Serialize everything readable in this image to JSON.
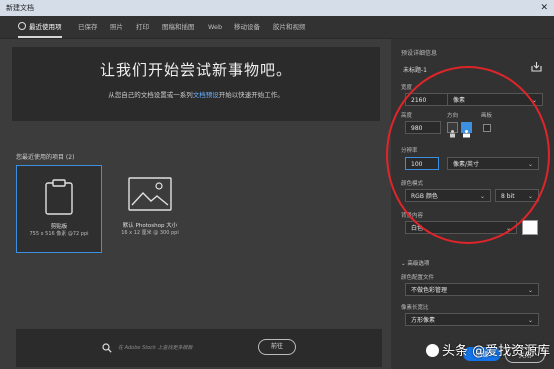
{
  "window": {
    "title": "新建文档",
    "close_glyph": "✕"
  },
  "tabs": [
    {
      "label": "最近使用项",
      "active": true
    },
    {
      "label": "已保存"
    },
    {
      "label": "照片"
    },
    {
      "label": "打印"
    },
    {
      "label": "图稿和插图"
    },
    {
      "label": "Web"
    },
    {
      "label": "移动设备"
    },
    {
      "label": "胶片和视频"
    }
  ],
  "hero": {
    "headline": "让我们开始尝试新事物吧。",
    "sub_before": "从您自己的文档设置或一系列",
    "sub_link": "文档预设",
    "sub_after": "开始以快速开始工作。"
  },
  "recent": {
    "label": "您最近使用的项目 (2)",
    "items": [
      {
        "name": "剪贴板",
        "dims": "755 x 516 像素 @72 ppi",
        "selected": true,
        "icon": "clipboard-icon"
      },
      {
        "name": "默认 Photoshop 大小",
        "dims": "16 x 12 厘米 @ 300 ppi",
        "selected": false,
        "icon": "image-icon"
      }
    ]
  },
  "stock": {
    "placeholder": "在 Adobe Stock 上查找更多模板",
    "go_label": "前往"
  },
  "preset": {
    "section_title": "预设详细信息",
    "doc_name": "未标题-1",
    "width_label": "宽度",
    "width_value": "2160",
    "width_unit": "像素",
    "height_label": "高度",
    "height_value": "980",
    "orientation_label": "方向",
    "artboard_label": "画板",
    "resolution_label": "分辨率",
    "resolution_value": "100",
    "resolution_unit": "像素/英寸",
    "color_mode_label": "颜色模式",
    "color_mode_value": "RGB 颜色",
    "bit_depth": "8 bit",
    "bg_label": "背景内容",
    "bg_value": "白色",
    "bg_color": "#ffffff",
    "advanced_label": "高级选项",
    "profile_label": "颜色配置文件",
    "profile_value": "不做色彩管理",
    "pixel_aspect_label": "像素长宽比",
    "pixel_aspect_value": "方形像素",
    "create_label": "创建",
    "close_label": "关闭"
  },
  "watermark": "头条 @爱找资源库",
  "colors": {
    "accent": "#3d8fe0",
    "annotation": "#e0252a"
  }
}
